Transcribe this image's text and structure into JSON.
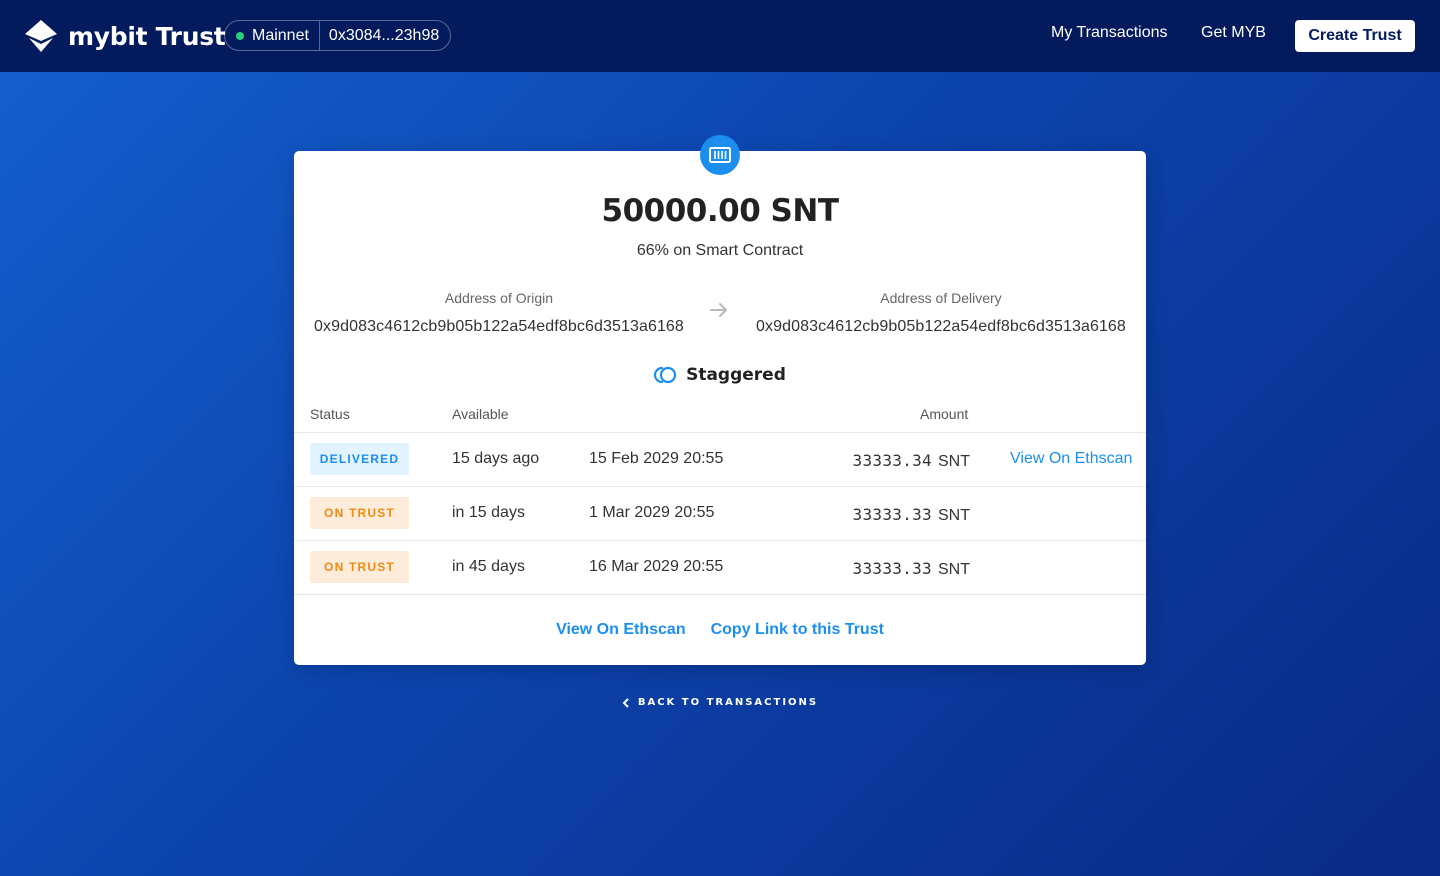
{
  "header": {
    "logo_text": "mybit Trust",
    "network": "Mainnet",
    "account": "0x3084...23h98",
    "nav": [
      "My Transactions",
      "Get MYB"
    ],
    "create_button": "Create Trust"
  },
  "card": {
    "amount": "50000.00 SNT",
    "subtitle": "66% on Smart Contract",
    "origin_label": "Address of Origin",
    "origin_address": "0x9d083c4612cb9b05b122a54edf8bc6d3513a6168",
    "delivery_label": "Address of Delivery",
    "delivery_address": "0x9d083c4612cb9b05b122a54edf8bc6d3513a6168",
    "mode": "Staggered",
    "columns": {
      "status": "Status",
      "available": "Available",
      "amount": "Amount"
    },
    "rows": [
      {
        "status": "DELIVERED",
        "relative": "15 days ago",
        "date": "15 Feb 2029 20:55",
        "amount": "33333.34",
        "unit": "SNT",
        "link": "View On Ethscan"
      },
      {
        "status": "ON TRUST",
        "relative": "in 15 days",
        "date": "1 Mar 2029 20:55",
        "amount": "33333.33",
        "unit": "SNT",
        "link": ""
      },
      {
        "status": "ON TRUST",
        "relative": "in 45 days",
        "date": "16 Mar 2029 20:55",
        "amount": "33333.33",
        "unit": "SNT",
        "link": ""
      }
    ],
    "footer_links": [
      "View On Ethscan",
      "Copy Link to this Trust"
    ]
  },
  "back_link": "BACK TO TRANSACTIONS",
  "colors": {
    "header_bg": "#031a5c",
    "accent": "#1c8ef0",
    "delivered": "#1c8ef0",
    "on_trust": "#f08a12"
  }
}
